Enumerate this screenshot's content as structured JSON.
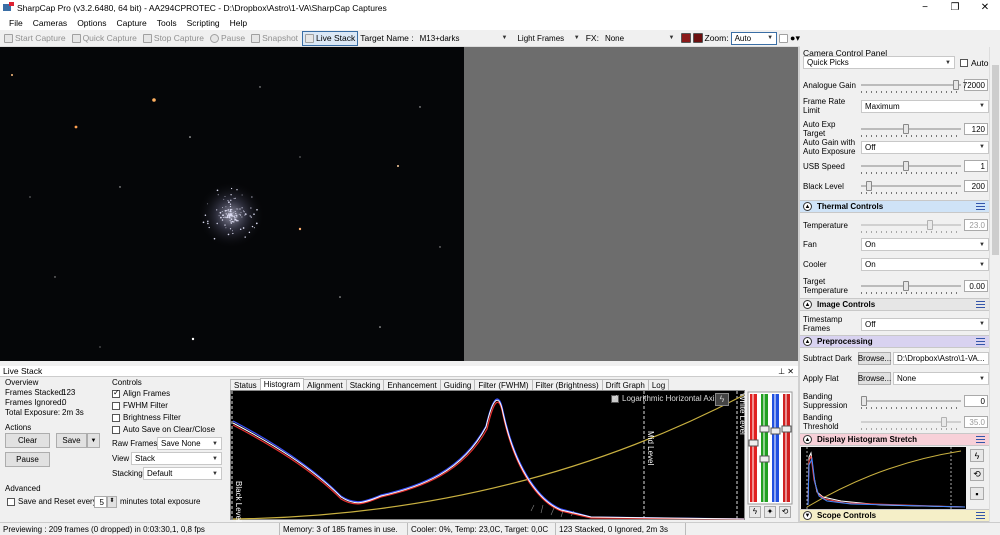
{
  "window": {
    "title": "SharpCap Pro (v3.2.6480, 64 bit) - AA294CPROTEC - D:\\Dropbox\\Astro\\1-VA\\SharpCap Captures",
    "minimize": "−",
    "maximize": "❐",
    "close": "✕"
  },
  "menu": [
    "File",
    "Cameras",
    "Options",
    "Capture",
    "Tools",
    "Scripting",
    "Help"
  ],
  "toolbar": {
    "start_capture": "Start Capture",
    "quick_capture": "Quick Capture",
    "stop_capture": "Stop Capture",
    "pause": "Pause",
    "snapshot": "Snapshot",
    "live_stack": "Live Stack",
    "target_name_label": "Target Name :",
    "target_name_value": "M13+darks",
    "frame_type": "Light Frames",
    "fx_label": "FX:",
    "fx_value": "None",
    "zoom_label": "Zoom:",
    "zoom_value": "Auto",
    "colors": {
      "red": "#8b1a1a",
      "dark_red": "#6b1010"
    }
  },
  "camera_panel": {
    "title": "Camera Control Panel",
    "quick_picks": "Quick Picks",
    "auto_label": "Auto",
    "analogue_gain": {
      "label": "Analogue Gain",
      "value": "72000",
      "level": 0.98
    },
    "frame_rate_limit": {
      "label": "Frame Rate Limit",
      "value": "Maximum"
    },
    "auto_exp_target": {
      "label": "Auto Exp Target",
      "value": "120",
      "level": 0.45
    },
    "auto_gain": {
      "label": "Auto Gain with Auto Exposure",
      "value": "Off"
    },
    "usb_speed": {
      "label": "USB Speed",
      "value": "1",
      "level": 0.45
    },
    "black_level": {
      "label": "Black Level",
      "value": "200",
      "level": 0.05
    },
    "thermal": {
      "title": "Thermal Controls",
      "temperature": {
        "label": "Temperature",
        "value": "23.0",
        "level": 0.7
      },
      "fan": {
        "label": "Fan",
        "value": "On"
      },
      "cooler": {
        "label": "Cooler",
        "value": "On"
      },
      "target_temperature": {
        "label": "Target Temperature",
        "value": "0.00",
        "level": 0.45
      }
    },
    "image": {
      "title": "Image Controls",
      "timestamp_frames": {
        "label": "Timestamp Frames",
        "value": "Off"
      }
    },
    "preprocessing": {
      "title": "Preprocessing",
      "subtract_dark": {
        "label": "Subtract Dark",
        "button": "Browse...",
        "value": "D:\\Dropbox\\Astro\\1-VA..."
      },
      "apply_flat": {
        "label": "Apply Flat",
        "button": "Browse...",
        "value": "None"
      },
      "banding_suppression": {
        "label": "Banding Suppression",
        "value": "0",
        "level": 0.0
      },
      "banding_threshold": {
        "label": "Banding Threshold",
        "value": "35.0",
        "level": 0.85
      }
    },
    "display_histogram": {
      "title": "Display Histogram Stretch"
    },
    "scope": {
      "title": "Scope Controls"
    },
    "colors": {
      "thermal": "#cfe3f7",
      "preprocessing": "#d8d2f0",
      "histogram": "#f7d0d8",
      "scope": "#f5efc8",
      "image": "#e6e6e6"
    }
  },
  "live_stack": {
    "title": "Live Stack",
    "overview_label": "Overview",
    "frames_stacked_label": "Frames Stacked:",
    "frames_stacked": "123",
    "frames_ignored_label": "Frames Ignored:",
    "frames_ignored": "0",
    "total_exposure_label": "Total Exposure:",
    "total_exposure": "2m 3s",
    "actions_label": "Actions",
    "clear": "Clear",
    "save": "Save",
    "pause": "Pause",
    "advanced_label": "Advanced",
    "save_reset_label": "Save and Reset every",
    "save_reset_value": "5",
    "save_reset_suffix": "minutes total exposure",
    "controls_label": "Controls",
    "align_frames": "Align Frames",
    "fwhm_filter": "FWHM Filter",
    "brightness_filter": "Brightness Filter",
    "auto_save": "Auto Save on Clear/Close",
    "raw_frames_label": "Raw Frames",
    "raw_frames_value": "Save None",
    "view_label": "View",
    "view_value": "Stack",
    "stacking_label": "Stacking",
    "stacking_value": "Default",
    "tabs": [
      "Status",
      "Histogram",
      "Alignment",
      "Stacking",
      "Enhancement",
      "Guiding",
      "Filter (FWHM)",
      "Filter (Brightness)",
      "Drift Graph",
      "Log"
    ],
    "active_tab": "Histogram",
    "log_axis_label": "Logarithmic Horizontal Axis",
    "black_level_label": "Black Level",
    "mid_level_label": "Mid Level",
    "white_level_label": "White Level"
  },
  "status": {
    "previewing": "Previewing : 209 frames (0 dropped) in 0:03:30,1, 0,8 fps",
    "memory": "Memory: 3 of 185 frames in use.",
    "cooler": "Cooler: 0%, Temp: 23,0C, Target: 0,0C",
    "stacked": "123 Stacked, 0 Ignored, 2m 3s"
  }
}
